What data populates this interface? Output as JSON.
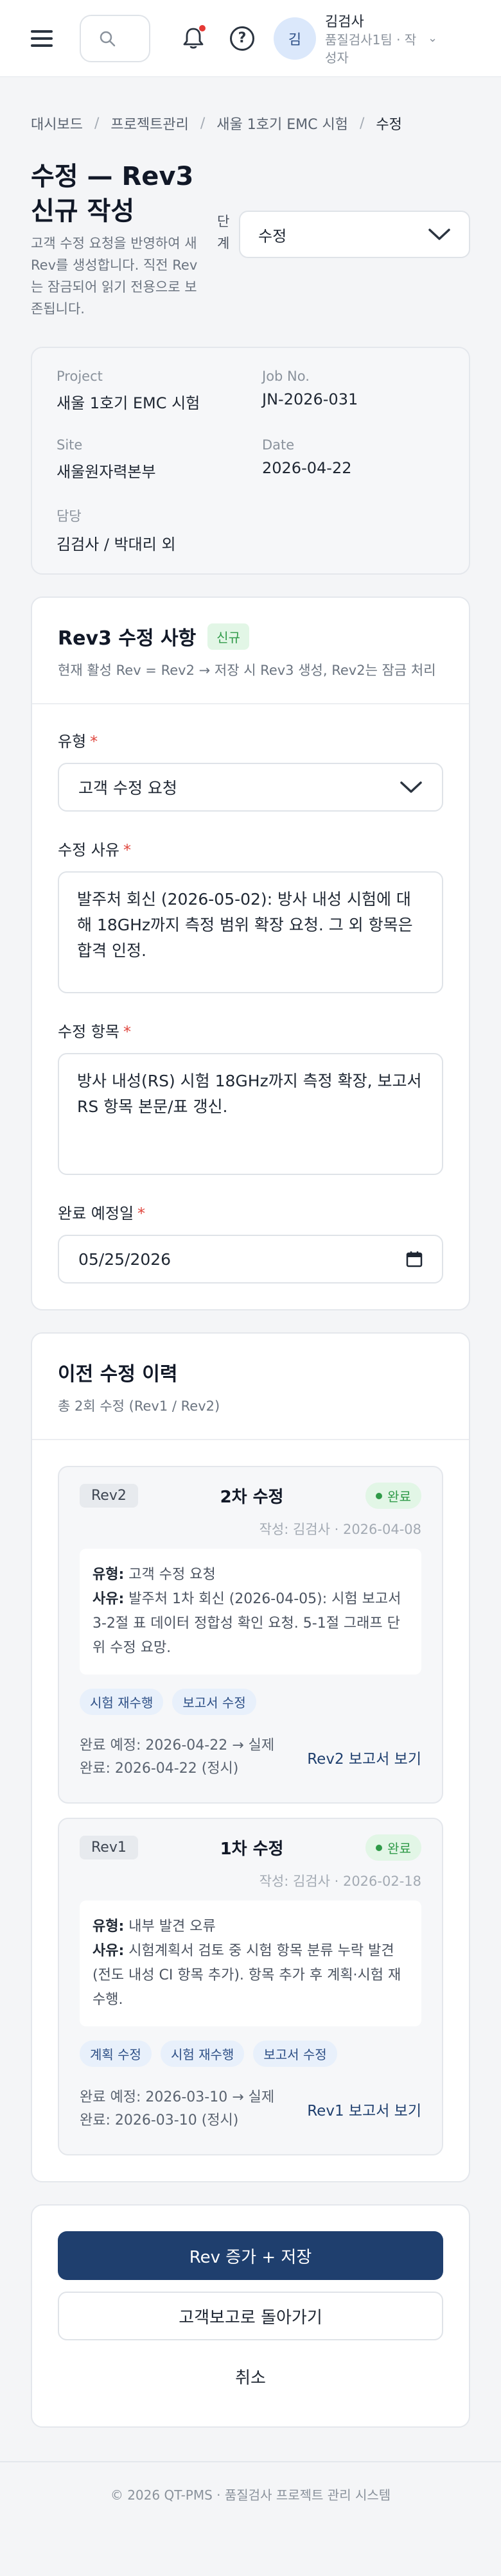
{
  "header": {
    "notification_dot_color": "#e53935",
    "user": {
      "avatar": "김",
      "name": "김검사",
      "team": "품질검사1팀 · 작성자"
    }
  },
  "breadcrumb": [
    "대시보드",
    "프로젝트관리",
    "새울 1호기 EMC 시험",
    "수정"
  ],
  "page": {
    "title_line1": "수정 — Rev3",
    "title_line2": "신규 작성",
    "description": "고객 수정 요청을 반영하여 새 Rev를 생성합니다. 직전 Rev는 잠금되어 읽기 전용으로 보존됩니다.",
    "stage_label": "단계",
    "stage_value": "수정"
  },
  "info": {
    "project_label": "Project",
    "project_value": "새울 1호기 EMC 시험",
    "job_label": "Job No.",
    "job_value": "JN-2026-031",
    "site_label": "Site",
    "site_value": "새울원자력본부",
    "date_label": "Date",
    "date_value": "2026-04-22",
    "owner_label": "담당",
    "owner_value": "김검사 / 박대리 외"
  },
  "form": {
    "title": "Rev3 수정 사항",
    "badge": "신규",
    "subtitle": "현재 활성 Rev = Rev2 → 저장 시 Rev3 생성, Rev2는 잠금 처리",
    "type_label": "유형",
    "type_value": "고객 수정 요청",
    "reason_label": "수정 사유",
    "reason_value": "발주처 회신 (2026-05-02): 방사 내성 시험에 대해 18GHz까지 측정 범위 확장 요청. 그 외 항목은 합격 인정.",
    "items_label": "수정 항목",
    "items_value": "방사 내성(RS) 시험 18GHz까지 측정 확장, 보고서 RS 항목 본문/표 갱신.",
    "due_label": "완료 예정일",
    "due_value": "05/25/2026",
    "required_mark": "*"
  },
  "history": {
    "title": "이전 수정 이력",
    "subtitle": "총 2회 수정 (Rev1 / Rev2)",
    "entries": [
      {
        "rev": "Rev2",
        "title": "2차 수정",
        "status": "완료",
        "meta": "작성: 김검사 · 2026-04-08",
        "type_label": "유형:",
        "type": "고객 수정 요청",
        "reason_label": "사유:",
        "reason": "발주처 1차 회신 (2026-04-05): 시험 보고서 3-2절 표 데이터 정합성 확인 요청. 5-1절 그래프 단위 수정 요망.",
        "tags": [
          "시험 재수행",
          "보고서 수정"
        ],
        "dates": "완료 예정: 2026-04-22 → 실제 완료: 2026-04-22 (정시)",
        "link": "Rev2 보고서 보기"
      },
      {
        "rev": "Rev1",
        "title": "1차 수정",
        "status": "완료",
        "meta": "작성: 김검사 · 2026-02-18",
        "type_label": "유형:",
        "type": "내부 발견 오류",
        "reason_label": "사유:",
        "reason": "시험계획서 검토 중 시험 항목 분류 누락 발견 (전도 내성 CI 항목 추가). 항목 추가 후 계획·시험 재수행.",
        "tags": [
          "계획 수정",
          "시험 재수행",
          "보고서 수정"
        ],
        "dates": "완료 예정: 2026-03-10 → 실제 완료: 2026-03-10 (정시)",
        "link": "Rev1 보고서 보기"
      }
    ]
  },
  "actions": {
    "primary": "Rev 증가 + 저장",
    "secondary": "고객보고로 돌아가기",
    "cancel": "취소"
  },
  "footer": "© 2026 QT-PMS · 품질검사 프로젝트 관리 시스템",
  "colors": {
    "primary": "#1f3f6e",
    "success": "#2f9a48",
    "required": "#e0473f"
  }
}
